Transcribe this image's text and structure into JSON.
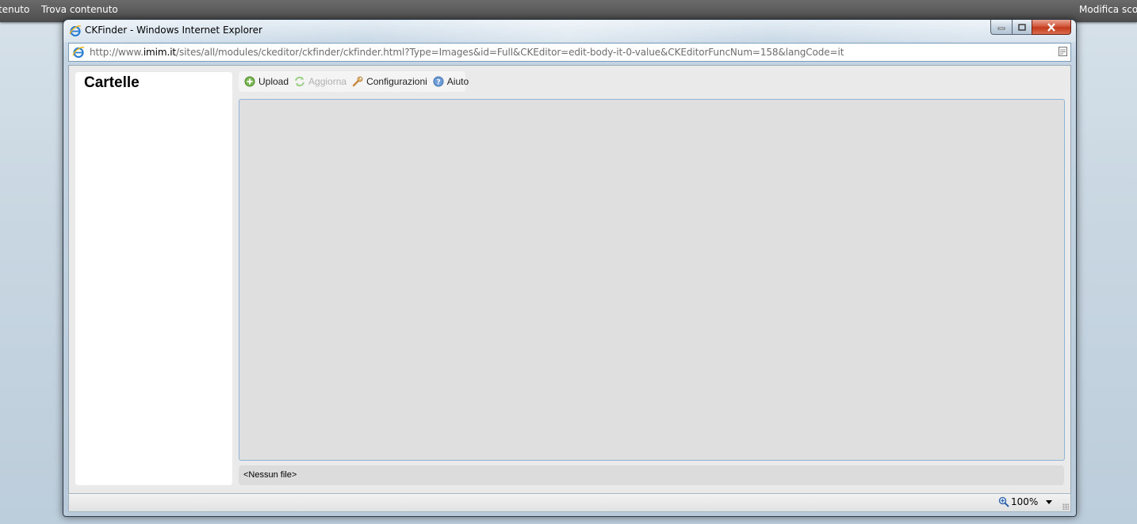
{
  "admin_bar": {
    "item_left": "tenuto",
    "item_find": "Trova contenuto",
    "item_right": "Modifica scor"
  },
  "window": {
    "title": "CKFinder - Windows Internet Explorer",
    "address": {
      "prefix": "http://www.",
      "domain": "imim.it",
      "path": "/sites/all/modules/ckeditor/ckfinder/ckfinder.html?Type=Images&id=Full&CKEditor=edit-body-it-0-value&CKEditorFuncNum=158&langCode=it"
    }
  },
  "ckfinder": {
    "folders_title": "Cartelle",
    "toolbar": {
      "upload": "Upload",
      "refresh": "Aggiorna",
      "settings": "Configurazioni",
      "help": "Aiuto"
    },
    "status": "<Nessun file>"
  },
  "ie_status": {
    "zoom": "100%"
  },
  "colors": {
    "admin_bar": "#555555",
    "close_button": "#c94a2c",
    "files_pane_border": "#8fb4d6",
    "disabled_text": "#b0b0b0"
  }
}
